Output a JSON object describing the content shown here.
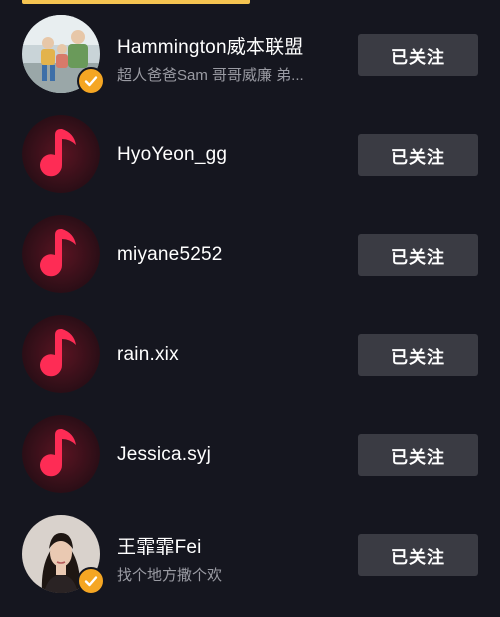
{
  "following_list": [
    {
      "name": "Hammington威本联盟",
      "subtitle": "超人爸爸Sam 哥哥威廉 弟...",
      "avatar": "family-photo",
      "verified": true,
      "button_label": "已关注"
    },
    {
      "name": "HyoYeon_gg",
      "subtitle": "",
      "avatar": "music-note-icon",
      "verified": false,
      "button_label": "已关注"
    },
    {
      "name": "miyane5252",
      "subtitle": "",
      "avatar": "music-note-icon",
      "verified": false,
      "button_label": "已关注"
    },
    {
      "name": "rain.xix",
      "subtitle": "",
      "avatar": "music-note-icon",
      "verified": false,
      "button_label": "已关注"
    },
    {
      "name": "Jessica.syj",
      "subtitle": "",
      "avatar": "music-note-icon",
      "verified": false,
      "button_label": "已关注"
    },
    {
      "name": "王霏霏Fei",
      "subtitle": "找个地方撒个欢",
      "avatar": "woman-photo",
      "verified": true,
      "button_label": "已关注"
    }
  ],
  "colors": {
    "background": "#15161f",
    "accent": "#f5c451",
    "button": "#3a3b43",
    "music_icon": "#fe2c55",
    "verified_badge": "#f5a623"
  }
}
